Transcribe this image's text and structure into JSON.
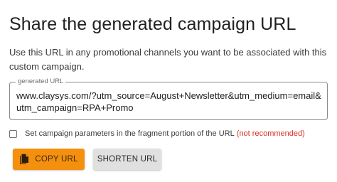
{
  "header": {
    "title": "Share the generated campaign URL"
  },
  "description": {
    "text": "Use this URL in any promotional channels you want to be associated with this custom campaign."
  },
  "url_field": {
    "label": "generated URL",
    "value": "www.claysys.com/?utm_source=August+Newsletter&utm_medium=email&utm_campaign=RPA+Promo"
  },
  "fragment_option": {
    "label": "Set campaign parameters in the fragment portion of the URL",
    "warning": "(not recommended)",
    "checked": false
  },
  "actions": {
    "copy_label": "COPY URL",
    "copy_icon": "copy-icon",
    "shorten_label": "SHORTEN URL"
  },
  "colors": {
    "accent": "#f5900f",
    "warning": "#d93025",
    "secondary_button": "#e0e0e0"
  }
}
